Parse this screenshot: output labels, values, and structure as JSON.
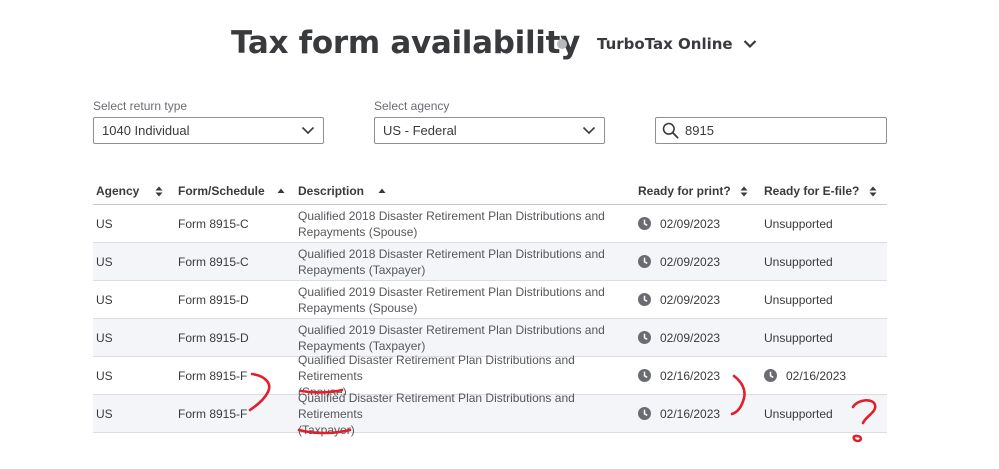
{
  "header": {
    "title": "Tax form availability",
    "product": "TurboTax Online"
  },
  "filters": {
    "return_type": {
      "label": "Select return type",
      "value": "1040 Individual"
    },
    "agency": {
      "label": "Select agency",
      "value": "US - Federal"
    },
    "search": {
      "value": "8915",
      "placeholder": ""
    }
  },
  "table": {
    "columns": [
      "Agency",
      "Form/Schedule",
      "Description",
      "Ready for print?",
      "Ready for E-file?"
    ],
    "rows": [
      {
        "agency": "US",
        "form": "Form 8915-C",
        "desc1": "Qualified 2018 Disaster Retirement Plan Distributions and",
        "desc2": "Repayments (Spouse)",
        "print": "02/09/2023",
        "efile": "Unsupported"
      },
      {
        "agency": "US",
        "form": "Form 8915-C",
        "desc1": "Qualified 2018 Disaster Retirement Plan Distributions and",
        "desc2": "Repayments (Taxpayer)",
        "print": "02/09/2023",
        "efile": "Unsupported"
      },
      {
        "agency": "US",
        "form": "Form 8915-D",
        "desc1": "Qualified 2019 Disaster Retirement Plan Distributions and",
        "desc2": "Repayments (Spouse)",
        "print": "02/09/2023",
        "efile": "Unsupported"
      },
      {
        "agency": "US",
        "form": "Form 8915-D",
        "desc1": "Qualified 2019 Disaster Retirement Plan Distributions and",
        "desc2": "Repayments (Taxpayer)",
        "print": "02/09/2023",
        "efile": "Unsupported"
      },
      {
        "agency": "US",
        "form": "Form 8915-F",
        "desc1": "Qualified Disaster Retirement Plan Distributions and Retirements",
        "desc2": "(Spouse)",
        "print": "02/16/2023",
        "efile": "02/16/2023"
      },
      {
        "agency": "US",
        "form": "Form 8915-F",
        "desc1": "Qualified Disaster Retirement Plan Distributions and Retirements",
        "desc2": "(Taxpayer)",
        "print": "02/16/2023",
        "efile": "Unsupported"
      }
    ]
  },
  "colors": {
    "text": "#393a3d",
    "alt_row": "#f4f5f8",
    "annotation": "#e0202a",
    "icon": "#6b6c72"
  },
  "icons": {
    "search": "search-icon",
    "clock": "clock-icon",
    "chevron": "chevron-down-icon",
    "sort": "sort-icon"
  }
}
